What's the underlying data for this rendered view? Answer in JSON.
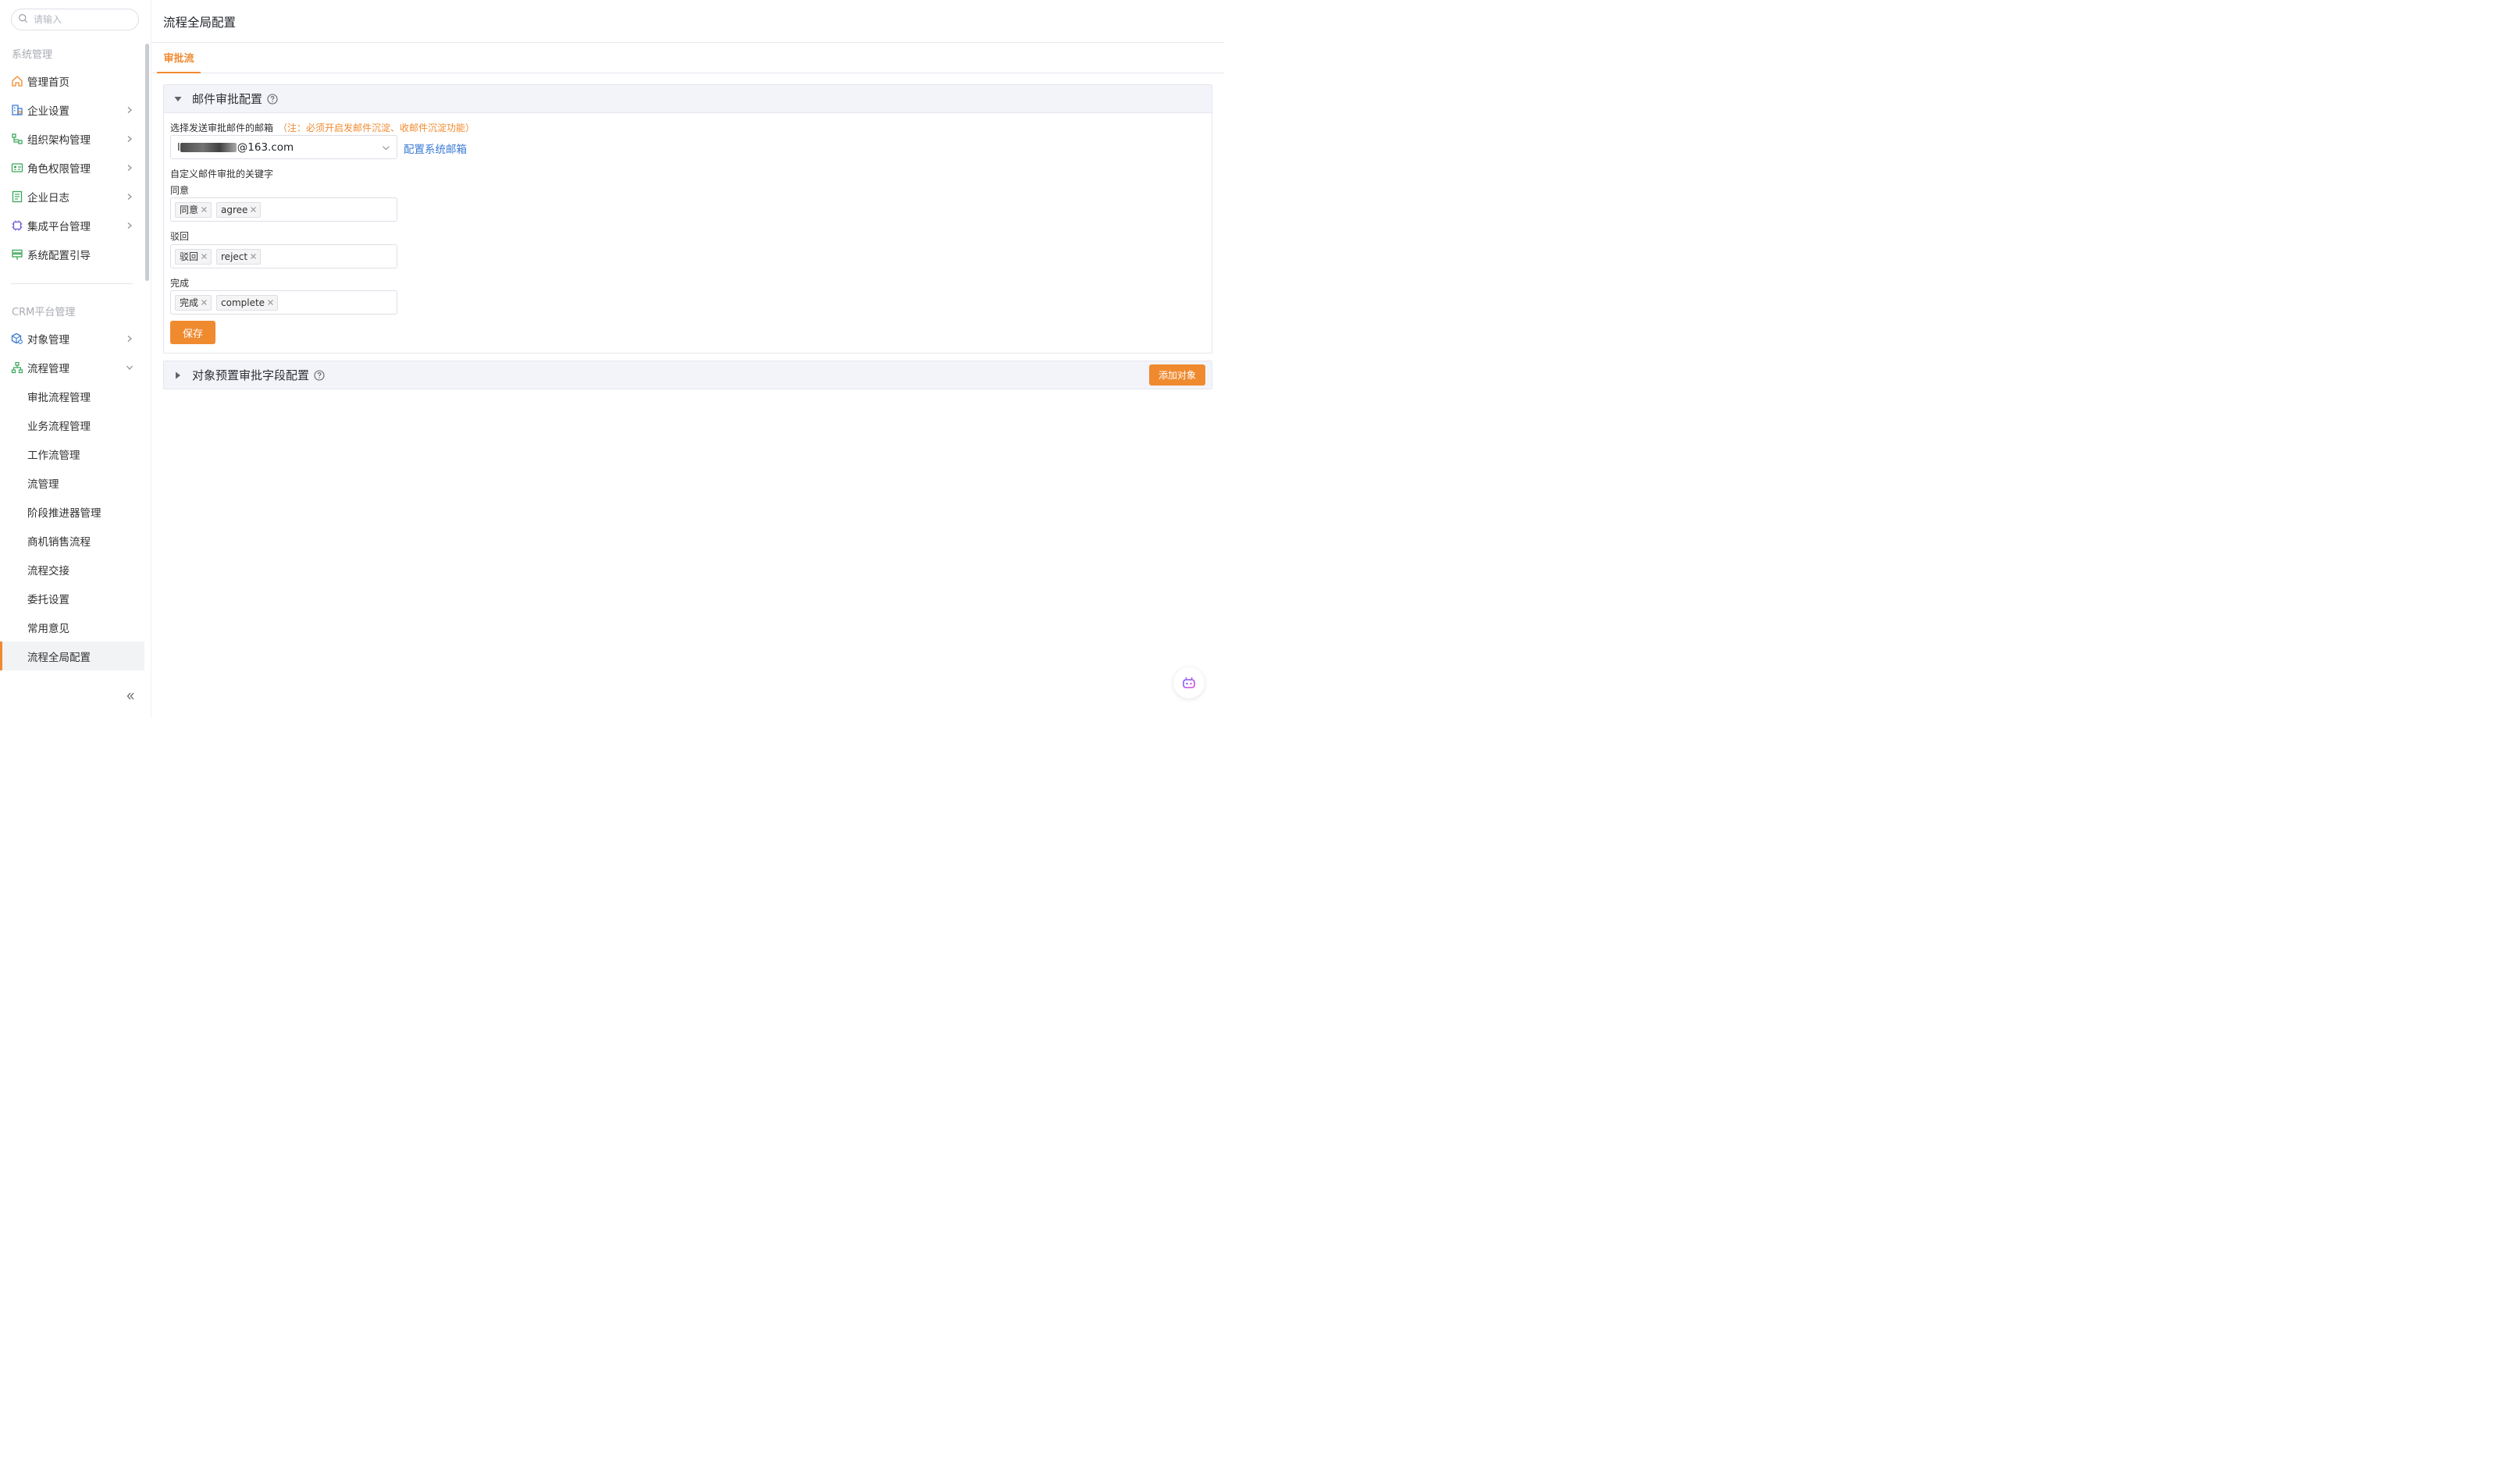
{
  "search": {
    "placeholder": "请输入"
  },
  "sidebar": {
    "section_system": "系统管理",
    "system_items": [
      {
        "label": "管理首页",
        "icon": "home-icon"
      },
      {
        "label": "企业设置",
        "icon": "building-icon"
      },
      {
        "label": "组织架构管理",
        "icon": "org-tree-icon"
      },
      {
        "label": "角色权限管理",
        "icon": "id-card-icon"
      },
      {
        "label": "企业日志",
        "icon": "log-icon"
      },
      {
        "label": "集成平台管理",
        "icon": "chip-icon"
      },
      {
        "label": "系统配置引导",
        "icon": "signpost-icon"
      }
    ],
    "section_crm": "CRM平台管理",
    "crm_items": [
      {
        "label": "对象管理",
        "icon": "cube-gear-icon"
      },
      {
        "label": "流程管理",
        "icon": "flow-icon"
      }
    ],
    "flow_sub_items": [
      "审批流程管理",
      "业务流程管理",
      "工作流管理",
      "流管理",
      "阶段推进器管理",
      "商机销售流程",
      "流程交接",
      "委托设置",
      "常用意见",
      "流程全局配置"
    ],
    "active_sub_item": "流程全局配置"
  },
  "page": {
    "title": "流程全局配置"
  },
  "tabs": [
    {
      "label": "审批流",
      "active": true
    }
  ],
  "email_panel": {
    "title": "邮件审批配置",
    "expanded": true,
    "mailbox_label": "选择发送审批邮件的邮箱",
    "mailbox_note": "（注：必须开启发邮件沉淀、收邮件沉淀功能）",
    "mailbox_prefix": "l",
    "mailbox_value": "@163.com",
    "config_link": "配置系统邮箱",
    "keywords_label": "自定义邮件审批的关键字",
    "groups": [
      {
        "label": "同意",
        "tags": [
          "同意",
          "agree"
        ]
      },
      {
        "label": "驳回",
        "tags": [
          "驳回",
          "reject"
        ]
      },
      {
        "label": "完成",
        "tags": [
          "完成",
          "complete"
        ]
      }
    ],
    "save_label": "保存"
  },
  "object_panel": {
    "title": "对象预置审批字段配置",
    "expanded": false,
    "add_label": "添加对象"
  },
  "colors": {
    "accent": "#f08a2f",
    "link": "#3a7bd5",
    "panel_header_bg": "#f3f4f9"
  }
}
